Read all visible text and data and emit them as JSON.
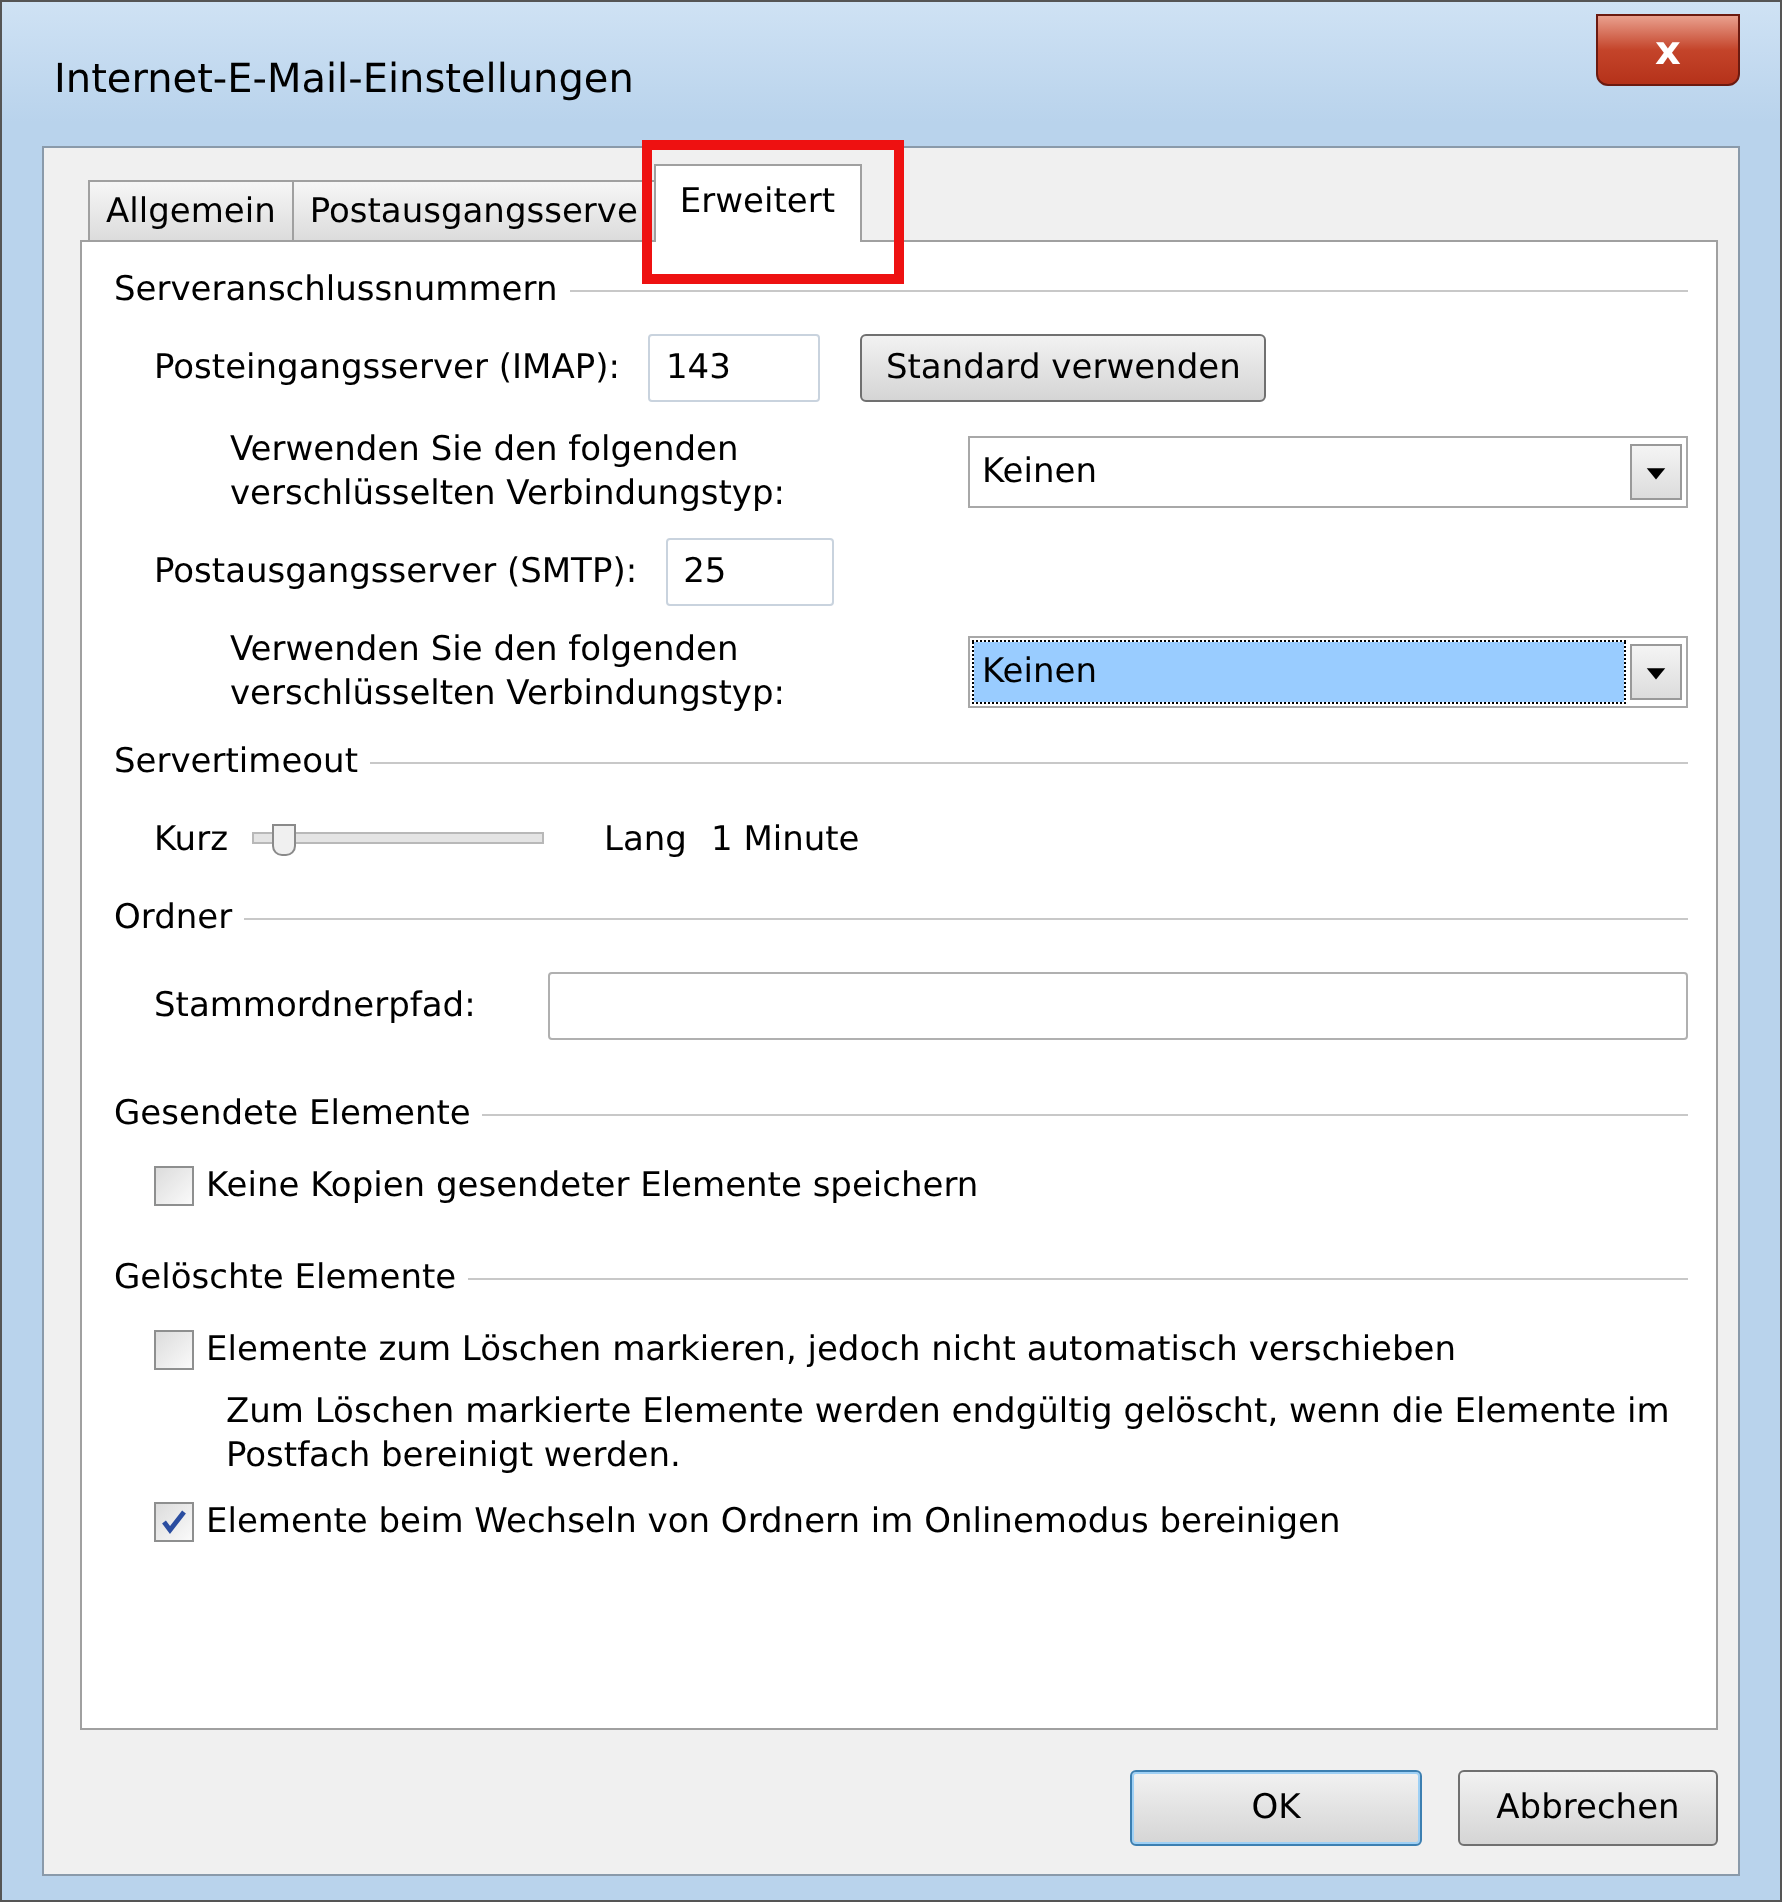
{
  "window": {
    "title": "Internet-E-Mail-Einstellungen",
    "close": "x"
  },
  "tabs": [
    {
      "label": "Allgemein",
      "selected": false,
      "highlighted": false
    },
    {
      "label": "Postausgangsserve",
      "selected": false,
      "highlighted": false
    },
    {
      "label": "Erweitert",
      "selected": true,
      "highlighted": true
    }
  ],
  "ports": {
    "title": "Serveranschlussnummern",
    "incoming": {
      "label": "Posteingangsserver (IMAP):",
      "value": "143",
      "button": "Standard verwenden",
      "encryption_label": "Verwenden Sie den folgenden verschlüsselten Verbindungstyp:",
      "encryption": "Keinen",
      "focused": false
    },
    "outgoing": {
      "label": "Postausgangsserver (SMTP):",
      "value": "25",
      "encryption_label": "Verwenden Sie den folgenden verschlüsselten Verbindungstyp:",
      "encryption": "Keinen",
      "focused": true
    }
  },
  "timeout": {
    "title": "Servertimeout",
    "min_label": "Kurz",
    "max_label": "Lang",
    "level": 0.1,
    "reading": "1 Minute"
  },
  "folders": {
    "title": "Ordner",
    "label": "Stammordnerpfad:"
  },
  "sent": {
    "title": "Gesendete Elemente",
    "options": [
      {
        "label": "Keine Kopien gesendeter Elemente speichern",
        "checked": false
      }
    ]
  },
  "deleted": {
    "title": "Gelöschte Elemente",
    "options": [
      {
        "label": "Elemente zum Löschen markieren, jedoch nicht automatisch verschieben",
        "checked": false,
        "note": "Zum Löschen markierte Elemente werden endgültig gelöscht, wenn die Elemente im Postfach bereinigt werden."
      },
      {
        "label": "Elemente beim Wechseln von Ordnern im Onlinemodus bereinigen",
        "checked": true
      }
    ]
  },
  "buttons": [
    {
      "label": "OK",
      "default": true
    },
    {
      "label": "Abbrechen",
      "default": false
    }
  ]
}
